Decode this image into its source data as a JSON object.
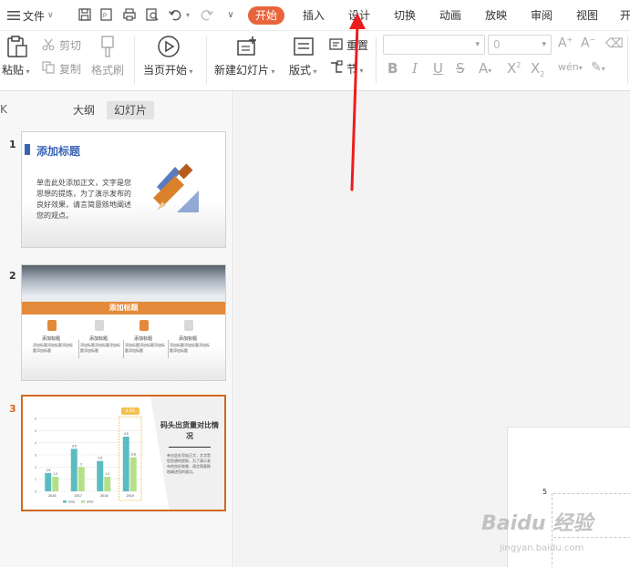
{
  "quick_access": {
    "file_label": "文件"
  },
  "tabs": [
    {
      "label": "开始",
      "active": true
    },
    {
      "label": "插入"
    },
    {
      "label": "设计"
    },
    {
      "label": "切换"
    },
    {
      "label": "动画"
    },
    {
      "label": "放映"
    },
    {
      "label": "审阅"
    },
    {
      "label": "视图"
    },
    {
      "label": "开"
    }
  ],
  "ribbon": {
    "paste": "粘贴",
    "cut": "剪切",
    "copy": "复制",
    "format_painter": "格式刷",
    "from_current": "当页开始",
    "new_slide": "新建幻灯片",
    "layout": "版式",
    "reset": "重置",
    "section": "节",
    "font_size": "0"
  },
  "panel": {
    "tabs": [
      {
        "label": "大纲"
      },
      {
        "label": "幻灯片",
        "active": true
      }
    ],
    "collapse_glyph": "K"
  },
  "slides": [
    {
      "number": "1",
      "title": "添加标题",
      "body": "单击此处添加正文，文字是您思想的提炼，为了演示发布的良好效果，请言简意赅地阐述您的观点。"
    },
    {
      "number": "2",
      "title": "添加标题",
      "columns": [
        {
          "heading": "添加标题",
          "body": "添加标题添加标题添加标题添加标题"
        },
        {
          "heading": "添加标题",
          "body": "添加标题添加标题添加标题添加标题"
        },
        {
          "heading": "添加标题",
          "body": "添加标题添加标题添加标题添加标题"
        },
        {
          "heading": "添加标题",
          "body": "添加标题添加标题添加标题添加标题"
        }
      ]
    },
    {
      "number": "3",
      "title": "码头出货量对比情况",
      "body": "单击此处添加正文，文字是您思想的提炼，为了演示发布的良好效果，请言简意赅地阐述您的观点。",
      "tag": "4.0%",
      "legend": [
        "系列1",
        "系列2"
      ],
      "categories": [
        "2016",
        "2017",
        "2018",
        "2019"
      ],
      "series_a": [
        1.5,
        3.5,
        2.5,
        4.5
      ],
      "series_b": [
        1.2,
        2.0,
        1.2,
        2.8
      ],
      "yticks": [
        "6",
        "5",
        "4",
        "3",
        "2",
        "1",
        "0"
      ]
    }
  ],
  "canvas": {
    "axis_label": "5"
  },
  "watermark": {
    "brand": "Baidu 经验",
    "url": "jingyan.baidu.com"
  },
  "colors": {
    "accent": "#E8643C",
    "title_blue": "#3C64B4",
    "orange": "#E3893A",
    "teal": "#5BBCC0",
    "green": "#B5E08A"
  }
}
